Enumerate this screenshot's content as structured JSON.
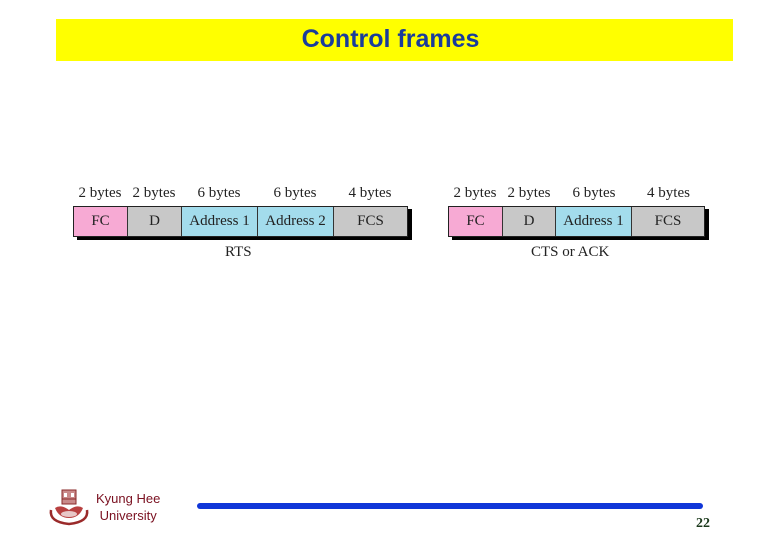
{
  "slide": {
    "title": "Control frames",
    "page_number": "22",
    "footer": {
      "university_line1": "Kyung Hee",
      "university_line2": "University",
      "logo_icon": "university-seal-icon",
      "accent_color": "#1036d8"
    },
    "title_bar_color": "#ffff00",
    "title_color": "#1a3c9c"
  },
  "frames": [
    {
      "caption": "RTS",
      "fields": [
        {
          "name": "FC",
          "size": "2 bytes",
          "color": "#f7aad4"
        },
        {
          "name": "D",
          "size": "2 bytes",
          "color": "#c8c8c8"
        },
        {
          "name": "Address 1",
          "size": "6 bytes",
          "color": "#a3dcec"
        },
        {
          "name": "Address 2",
          "size": "6 bytes",
          "color": "#a3dcec"
        },
        {
          "name": "FCS",
          "size": "4 bytes",
          "color": "#c8c8c8"
        }
      ]
    },
    {
      "caption": "CTS or ACK",
      "fields": [
        {
          "name": "FC",
          "size": "2 bytes",
          "color": "#f7aad4"
        },
        {
          "name": "D",
          "size": "2 bytes",
          "color": "#c8c8c8"
        },
        {
          "name": "Address 1",
          "size": "6 bytes",
          "color": "#a3dcec"
        },
        {
          "name": "FCS",
          "size": "4 bytes",
          "color": "#c8c8c8"
        }
      ]
    }
  ]
}
